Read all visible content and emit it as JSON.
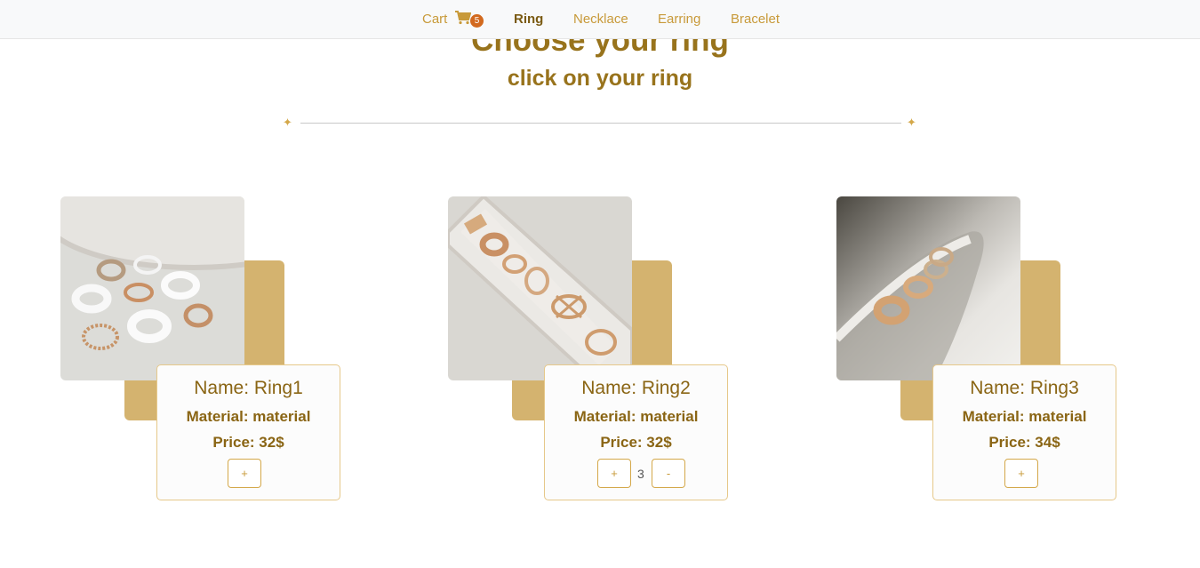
{
  "nav": {
    "cart_label": "Cart",
    "cart_count": "5",
    "links": [
      "Ring",
      "Necklace",
      "Earring",
      "Bracelet"
    ],
    "active": "Ring"
  },
  "header": {
    "title": "Choose your ring",
    "subtitle": "click on your ring"
  },
  "divider": {
    "ornament": "✦"
  },
  "products": [
    {
      "name": "Name: Ring1",
      "material": "Material: material",
      "price": "Price: 32$",
      "add_label": "+",
      "quantity": null
    },
    {
      "name": "Name: Ring2",
      "material": "Material: material",
      "price": "Price: 32$",
      "add_label": "+",
      "quantity": "3",
      "remove_label": "-"
    },
    {
      "name": "Name: Ring3",
      "material": "Material: material",
      "price": "Price: 34$",
      "add_label": "+",
      "quantity": null
    }
  ],
  "colors": {
    "accent": "#c89a3a",
    "title": "#98731c",
    "card_backdrop": "#d4b36f",
    "badge": "#d2691e"
  },
  "icons": {
    "cart": "shopping-cart-icon",
    "ornament": "sparkle-icon"
  }
}
